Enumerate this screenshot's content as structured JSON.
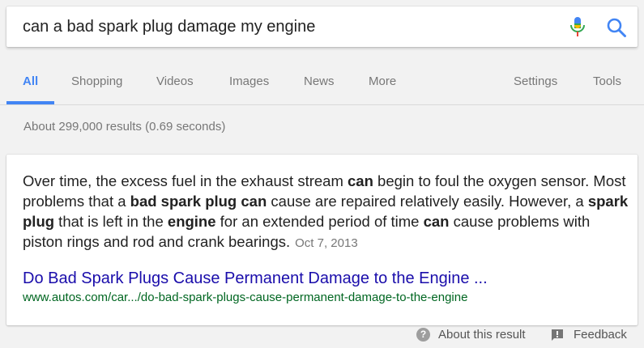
{
  "search": {
    "query": "can a bad spark plug damage my engine"
  },
  "tabs": [
    {
      "label": "All"
    },
    {
      "label": "Shopping"
    },
    {
      "label": "Videos"
    },
    {
      "label": "Images"
    },
    {
      "label": "News"
    },
    {
      "label": "More"
    },
    {
      "label": "Settings"
    },
    {
      "label": "Tools"
    }
  ],
  "results_stats": "About 299,000 results (0.69 seconds)",
  "featured_snippet": {
    "segments": [
      {
        "text": "Over time, the excess fuel in the exhaust stream ",
        "bold": false
      },
      {
        "text": "can",
        "bold": true
      },
      {
        "text": " begin to foul the oxygen sensor. Most problems that a ",
        "bold": false
      },
      {
        "text": "bad spark plug can",
        "bold": true
      },
      {
        "text": " cause are repaired relatively easily. However, a ",
        "bold": false
      },
      {
        "text": "spark plug",
        "bold": true
      },
      {
        "text": " that is left in the ",
        "bold": false
      },
      {
        "text": "engine",
        "bold": true
      },
      {
        "text": " for an extended period of time ",
        "bold": false
      },
      {
        "text": "can",
        "bold": true
      },
      {
        "text": " cause problems with piston rings and rod and crank bearings.",
        "bold": false
      }
    ],
    "date": "Oct 7, 2013",
    "title": "Do Bad Spark Plugs Cause Permanent Damage to the Engine ...",
    "url": "www.autos.com/car.../do-bad-spark-plugs-cause-permanent-damage-to-the-engine"
  },
  "footer": {
    "about": "About this result",
    "feedback": "Feedback"
  },
  "colors": {
    "accent": "#4285f4",
    "link": "#1a0dab",
    "url": "#006621"
  }
}
